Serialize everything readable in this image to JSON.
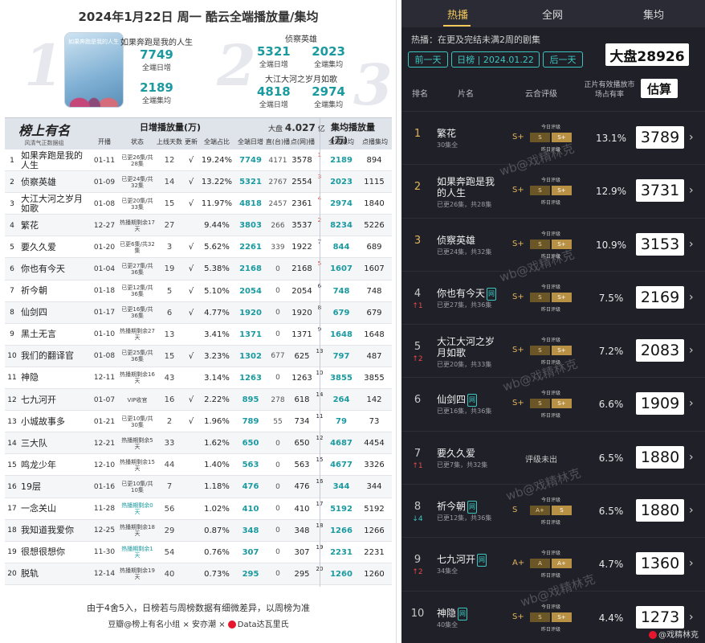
{
  "left": {
    "title": "2024年1月22日 周一  酷云全端播放量/集均",
    "big_nums": [
      "1",
      "2",
      "3"
    ],
    "poster_text": "如果奔跑是我的人生",
    "highlights": [
      {
        "name": "如果奔跑是我的人生",
        "daily": "7749",
        "daily_label": "全端日增",
        "avg": "2189",
        "avg_label": "全端集均"
      },
      {
        "name": "侦察英雄",
        "daily": "5321",
        "daily_label": "全端日增",
        "avg": "2023",
        "avg_label": "全端集均"
      },
      {
        "name": "大江大河之岁月如歌",
        "daily": "4818",
        "daily_label": "全端日增",
        "avg": "2974",
        "avg_label": "全端集均"
      }
    ],
    "brand_main": "榜上有名",
    "brand_sub": "风清气正数据组",
    "header": {
      "daily_group": "日增播放量(万)",
      "dapan_label": "大盘",
      "dapan_value": "4.027",
      "dapan_unit": "亿",
      "avg_group": "集均播放量(万)",
      "cols": [
        "开播",
        "状态",
        "上线天数",
        "更新",
        "全端占比",
        "全端日增",
        "直(台)播",
        "点(网)播",
        "全端集均",
        "点播集均"
      ]
    },
    "rows": [
      {
        "rank": "1",
        "name": "如果奔跑是我的人生",
        "date": "01-11",
        "status": "已更26集/共28集",
        "days": "12",
        "upd": "√",
        "share": "19.24%",
        "all": "7749",
        "zhi": "4171",
        "dian": "3578",
        "rk2": "1",
        "avg": "2189",
        "pavg": "894"
      },
      {
        "rank": "2",
        "name": "侦察英雄",
        "date": "01-09",
        "status": "已更24集/共32集",
        "days": "14",
        "upd": "√",
        "share": "13.22%",
        "all": "5321",
        "zhi": "2767",
        "dian": "2554",
        "rk2": "3",
        "avg": "2023",
        "pavg": "1115"
      },
      {
        "rank": "3",
        "name": "大江大河之岁月如歌",
        "date": "01-08",
        "status": "已更20集/共33集",
        "days": "15",
        "upd": "√",
        "share": "11.97%",
        "all": "4818",
        "zhi": "2457",
        "dian": "2361",
        "rk2": "4",
        "avg": "2974",
        "pavg": "1840"
      },
      {
        "rank": "4",
        "name": "繁花",
        "date": "12-27",
        "status": "热播期剩余17天",
        "days": "27",
        "upd": "",
        "share": "9.44%",
        "all": "3803",
        "zhi": "266",
        "dian": "3537",
        "rk2": "2",
        "avg": "8234",
        "pavg": "5226"
      },
      {
        "rank": "5",
        "name": "要久久爱",
        "date": "01-20",
        "status": "已更6集/共32集",
        "days": "3",
        "upd": "√",
        "share": "5.62%",
        "all": "2261",
        "zhi": "339",
        "dian": "1922",
        "rk2": "7",
        "avg": "844",
        "pavg": "689"
      },
      {
        "rank": "6",
        "name": "你也有今天",
        "date": "01-04",
        "status": "已更27集/共36集",
        "days": "19",
        "upd": "√",
        "share": "5.38%",
        "all": "2168",
        "zhi": "0",
        "dian": "2168",
        "rk2": "5",
        "avg": "1607",
        "pavg": "1607"
      },
      {
        "rank": "7",
        "name": "祈今朝",
        "date": "01-18",
        "status": "已更12集/共36集",
        "days": "5",
        "upd": "√",
        "share": "5.10%",
        "all": "2054",
        "zhi": "0",
        "dian": "2054",
        "rk2": "6",
        "avg": "748",
        "pavg": "748"
      },
      {
        "rank": "8",
        "name": "仙剑四",
        "date": "01-17",
        "status": "已更16集/共36集",
        "days": "6",
        "upd": "√",
        "share": "4.77%",
        "all": "1920",
        "zhi": "0",
        "dian": "1920",
        "rk2": "8",
        "avg": "679",
        "pavg": "679"
      },
      {
        "rank": "9",
        "name": "黑土无言",
        "date": "01-10",
        "status": "热播期剩余27天",
        "days": "13",
        "upd": "",
        "share": "3.41%",
        "all": "1371",
        "zhi": "0",
        "dian": "1371",
        "rk2": "9",
        "avg": "1648",
        "pavg": "1648"
      },
      {
        "rank": "10",
        "name": "我们的翻译官",
        "date": "01-08",
        "status": "已更25集/共36集",
        "days": "15",
        "upd": "√",
        "share": "3.23%",
        "all": "1302",
        "zhi": "677",
        "dian": "625",
        "rk2": "13",
        "avg": "797",
        "pavg": "487"
      },
      {
        "rank": "11",
        "name": "神隐",
        "date": "12-11",
        "status": "热播期剩余16天",
        "days": "43",
        "upd": "",
        "share": "3.14%",
        "all": "1263",
        "zhi": "0",
        "dian": "1263",
        "rk2": "10",
        "avg": "3855",
        "pavg": "3855"
      },
      {
        "rank": "12",
        "name": "七九河开",
        "date": "01-07",
        "status": "VIP收官",
        "days": "16",
        "upd": "√",
        "share": "2.22%",
        "all": "895",
        "zhi": "278",
        "dian": "618",
        "rk2": "14",
        "avg": "264",
        "pavg": "142"
      },
      {
        "rank": "13",
        "name": "小城故事多",
        "date": "01-21",
        "status": "已更10集/共30集",
        "days": "2",
        "upd": "√",
        "share": "1.96%",
        "all": "789",
        "zhi": "55",
        "dian": "734",
        "rk2": "11",
        "avg": "79",
        "pavg": "73"
      },
      {
        "rank": "14",
        "name": "三大队",
        "date": "12-21",
        "status": "热播期剩余5天",
        "days": "33",
        "upd": "",
        "share": "1.62%",
        "all": "650",
        "zhi": "0",
        "dian": "650",
        "rk2": "12",
        "avg": "4687",
        "pavg": "4454"
      },
      {
        "rank": "15",
        "name": "鸣龙少年",
        "date": "12-10",
        "status": "热播期剩余15天",
        "days": "44",
        "upd": "",
        "share": "1.40%",
        "all": "563",
        "zhi": "0",
        "dian": "563",
        "rk2": "15",
        "avg": "4677",
        "pavg": "3326"
      },
      {
        "rank": "16",
        "name": "19层",
        "date": "01-16",
        "status": "已更10集/共10集",
        "days": "7",
        "upd": "",
        "share": "1.18%",
        "all": "476",
        "zhi": "0",
        "dian": "476",
        "rk2": "16",
        "avg": "344",
        "pavg": "344"
      },
      {
        "rank": "17",
        "name": "一念关山",
        "date": "11-28",
        "status": "热播期剩余0天",
        "days": "56",
        "upd": "",
        "share": "1.02%",
        "all": "410",
        "zhi": "0",
        "dian": "410",
        "rk2": "17",
        "avg": "5192",
        "pavg": "5192"
      },
      {
        "rank": "18",
        "name": "我知道我爱你",
        "date": "12-25",
        "status": "热播期剩余18天",
        "days": "29",
        "upd": "",
        "share": "0.87%",
        "all": "348",
        "zhi": "0",
        "dian": "348",
        "rk2": "18",
        "avg": "1266",
        "pavg": "1266"
      },
      {
        "rank": "19",
        "name": "很想很想你",
        "date": "11-30",
        "status": "热播期剩余1天",
        "days": "54",
        "upd": "",
        "share": "0.76%",
        "all": "307",
        "zhi": "0",
        "dian": "307",
        "rk2": "19",
        "avg": "2231",
        "pavg": "2231"
      },
      {
        "rank": "20",
        "name": "脱轨",
        "date": "12-14",
        "status": "热播期剩余19天",
        "days": "40",
        "upd": "",
        "share": "0.73%",
        "all": "295",
        "zhi": "0",
        "dian": "295",
        "rk2": "20",
        "avg": "1260",
        "pavg": "1260"
      }
    ],
    "footer_note": "由于4舍5入，日榜若与周榜数据有细微差异，以周榜为准",
    "footer_credit": "豆瓣@榜上有名小组 × 安亦潮 × ",
    "footer_credit2": "Data达瓦里氏"
  },
  "right": {
    "tabs": [
      "热播",
      "全网",
      "集均"
    ],
    "note": "热播：在更及完结未满2周的剧集",
    "prev": "前一天",
    "date": "日榜 | 2024.01.22",
    "next": "后一天",
    "dapan": "大盘28926",
    "col_rank": "排名",
    "col_name": "片名",
    "col_rating": "云合评级",
    "col_share": "正片有效播放市场占有率",
    "gusuan": "估算",
    "today_label": "今日评级",
    "yesterday_label": "昨日评级",
    "no_rating": "评级未出",
    "watermark": "wb@戏精林克",
    "credit": "@戏精林克",
    "items": [
      {
        "rank": "1",
        "name": "繁花",
        "net": "",
        "sub": "30集全",
        "chg": "",
        "lead": "S+",
        "segs": [
          "S",
          "S+"
        ],
        "on": 1,
        "share": "13.1%",
        "est": "3789"
      },
      {
        "rank": "2",
        "name": "如果奔跑是我的人生",
        "net": "",
        "sub": "已更26集，共28集",
        "chg": "",
        "lead": "S+",
        "segs": [
          "S",
          "S+"
        ],
        "on": 1,
        "share": "12.9%",
        "est": "3731"
      },
      {
        "rank": "3",
        "name": "侦察英雄",
        "net": "",
        "sub": "已更24集，共32集",
        "chg": "",
        "lead": "S+",
        "segs": [
          "S",
          "S+"
        ],
        "on": 1,
        "share": "10.9%",
        "est": "3153"
      },
      {
        "rank": "4",
        "name": "你也有今天",
        "net": "网",
        "sub": "已更27集，共36集",
        "chg": "↑1",
        "chg_dir": "up",
        "lead": "S+",
        "segs": [
          "S",
          "S+"
        ],
        "on": 1,
        "share": "7.5%",
        "est": "2169"
      },
      {
        "rank": "5",
        "name": "大江大河之岁月如歌",
        "net": "",
        "sub": "已更20集，共33集",
        "chg": "↑2",
        "chg_dir": "up",
        "lead": "S+",
        "segs": [
          "S",
          "S+"
        ],
        "on": 1,
        "share": "7.2%",
        "est": "2083"
      },
      {
        "rank": "6",
        "name": "仙剑四",
        "net": "网",
        "sub": "已更16集，共36集",
        "chg": "",
        "lead": "S+",
        "segs": [
          "S",
          "S+"
        ],
        "on": 1,
        "share": "6.6%",
        "est": "1909"
      },
      {
        "rank": "7",
        "name": "要久久爱",
        "net": "",
        "sub": "已更7集，共32集",
        "chg": "↑1",
        "chg_dir": "up",
        "lead": "",
        "segs": [],
        "on": 0,
        "share": "6.5%",
        "est": "1880"
      },
      {
        "rank": "8",
        "name": "祈今朝",
        "net": "网",
        "sub": "已更12集，共36集",
        "chg": "↓4",
        "chg_dir": "down",
        "lead": "S",
        "segs": [
          "A+",
          "S"
        ],
        "on": 1,
        "share": "6.5%",
        "est": "1880"
      },
      {
        "rank": "9",
        "name": "七九河开",
        "net": "网",
        "sub": "34集全",
        "chg": "↑2",
        "chg_dir": "up",
        "lead": "A+",
        "segs": [
          "A",
          "A+"
        ],
        "on": 1,
        "share": "4.7%",
        "est": "1360"
      },
      {
        "rank": "10",
        "name": "神隐",
        "net": "网",
        "sub": "40集全",
        "chg": "",
        "lead": "S+",
        "segs": [
          "S",
          "S+"
        ],
        "on": 1,
        "share": "4.4%",
        "est": "1273"
      }
    ]
  }
}
